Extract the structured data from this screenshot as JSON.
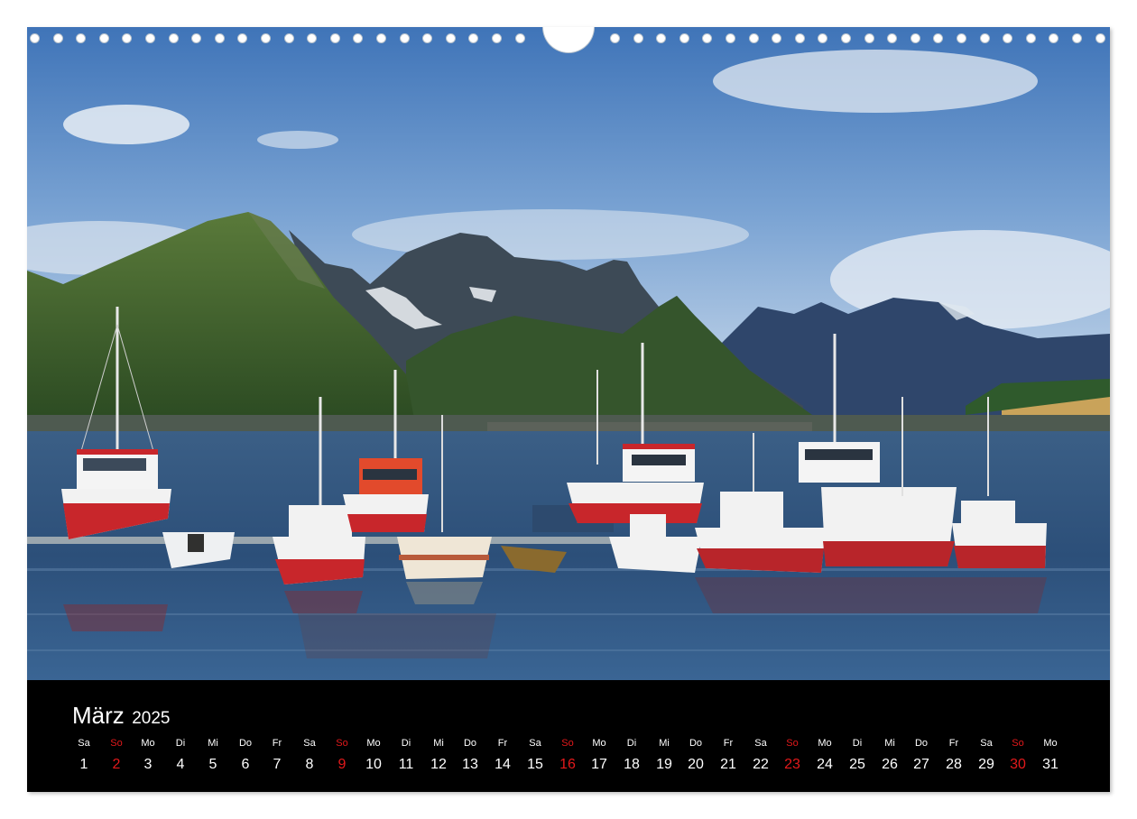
{
  "calendar": {
    "month": "März",
    "year": "2025",
    "days": [
      {
        "wd": "Sa",
        "d": "1",
        "sun": false
      },
      {
        "wd": "So",
        "d": "2",
        "sun": true
      },
      {
        "wd": "Mo",
        "d": "3",
        "sun": false
      },
      {
        "wd": "Di",
        "d": "4",
        "sun": false
      },
      {
        "wd": "Mi",
        "d": "5",
        "sun": false
      },
      {
        "wd": "Do",
        "d": "6",
        "sun": false
      },
      {
        "wd": "Fr",
        "d": "7",
        "sun": false
      },
      {
        "wd": "Sa",
        "d": "8",
        "sun": false
      },
      {
        "wd": "So",
        "d": "9",
        "sun": true
      },
      {
        "wd": "Mo",
        "d": "10",
        "sun": false
      },
      {
        "wd": "Di",
        "d": "11",
        "sun": false
      },
      {
        "wd": "Mi",
        "d": "12",
        "sun": false
      },
      {
        "wd": "Do",
        "d": "13",
        "sun": false
      },
      {
        "wd": "Fr",
        "d": "14",
        "sun": false
      },
      {
        "wd": "Sa",
        "d": "15",
        "sun": false
      },
      {
        "wd": "So",
        "d": "16",
        "sun": true
      },
      {
        "wd": "Mo",
        "d": "17",
        "sun": false
      },
      {
        "wd": "Di",
        "d": "18",
        "sun": false
      },
      {
        "wd": "Mi",
        "d": "19",
        "sun": false
      },
      {
        "wd": "Do",
        "d": "20",
        "sun": false
      },
      {
        "wd": "Fr",
        "d": "21",
        "sun": false
      },
      {
        "wd": "Sa",
        "d": "22",
        "sun": false
      },
      {
        "wd": "So",
        "d": "23",
        "sun": true
      },
      {
        "wd": "Mo",
        "d": "24",
        "sun": false
      },
      {
        "wd": "Di",
        "d": "25",
        "sun": false
      },
      {
        "wd": "Mi",
        "d": "26",
        "sun": false
      },
      {
        "wd": "Do",
        "d": "27",
        "sun": false
      },
      {
        "wd": "Fr",
        "d": "28",
        "sun": false
      },
      {
        "wd": "Sa",
        "d": "29",
        "sun": false
      },
      {
        "wd": "So",
        "d": "30",
        "sun": true
      },
      {
        "wd": "Mo",
        "d": "31",
        "sun": false
      }
    ]
  },
  "colors": {
    "sunday": "#e3191b",
    "calendar_bg": "#000000",
    "text": "#ffffff"
  }
}
